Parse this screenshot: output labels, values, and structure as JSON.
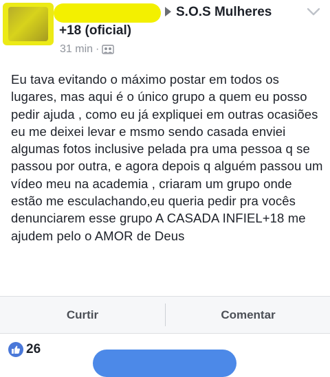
{
  "post": {
    "group_name": "S.O.S Mulheres +18 (oficial)",
    "time": "31 min",
    "meta_separator": "·",
    "text": "Eu tava evitando o máximo postar em todos os lugares, mas aqui é o único grupo a quem eu posso pedir ajuda , como eu já expliquei em outras ocasiões eu me deixei levar e msmo sendo casada enviei algumas fotos inclusive pelada pra uma pessoa q se passou por outra, e agora depois q alguém passou um vídeo meu na academia , criaram um grupo onde estão me esculachando,eu queria pedir pra vocês denunciarem esse grupo A CASADA INFIEL+18 me ajudem pelo o AMOR de Deus"
  },
  "actions": {
    "like_label": "Curtir",
    "comment_label": "Comentar"
  },
  "reactions": {
    "like_count": "26"
  },
  "icons": {
    "arrow": "right-arrow-icon",
    "chevron": "chevron-down-icon",
    "audience": "group-audience-icon",
    "like": "like-thumb-icon"
  },
  "colors": {
    "redaction": "#f3f000",
    "like_blue": "#4a78d9",
    "meta_gray": "#90949c"
  }
}
